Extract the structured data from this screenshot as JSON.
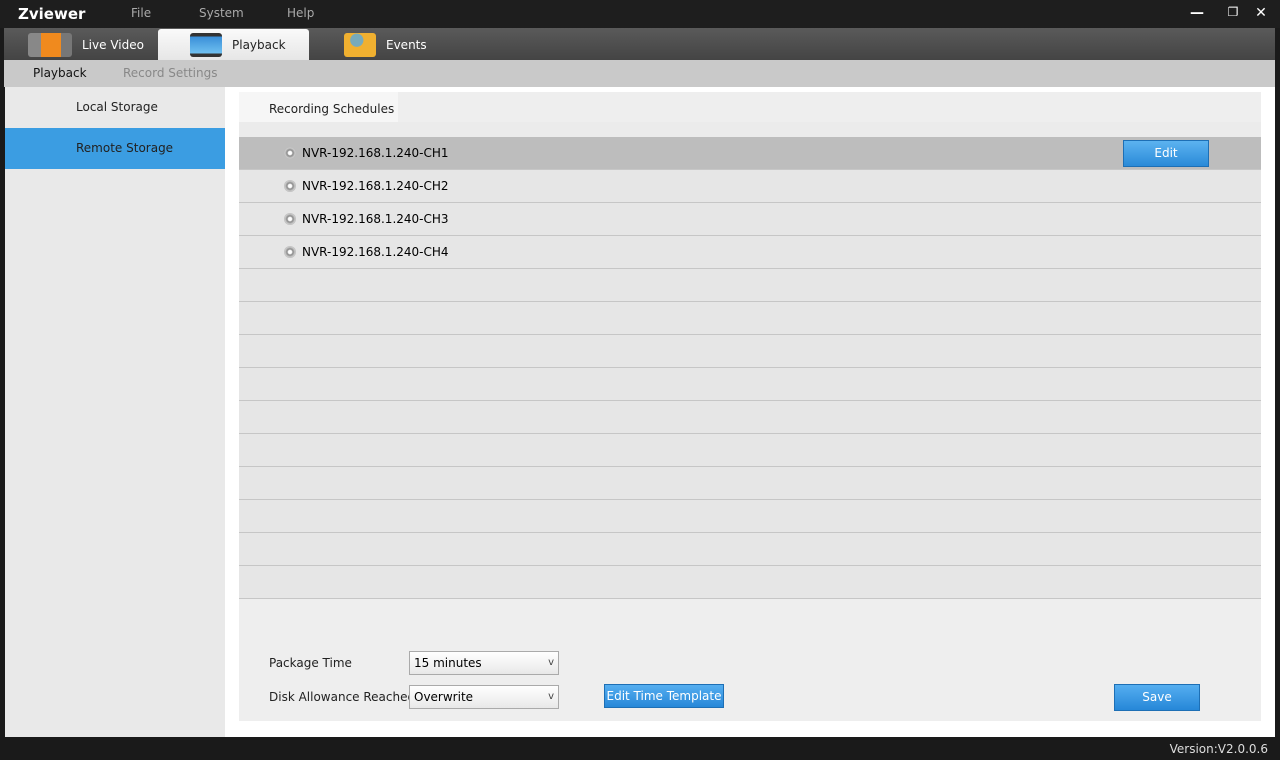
{
  "app": {
    "title": "Zviewer",
    "menu": [
      "File",
      "System",
      "Help"
    ],
    "window_controls": [
      "minimize-icon",
      "restore-icon",
      "close-icon"
    ]
  },
  "tabs": [
    {
      "label": "Live Video",
      "icon": "video-camera-icon"
    },
    {
      "label": "Playback",
      "icon": "filmstrip-icon",
      "active": true
    },
    {
      "label": "Events",
      "icon": "folder-icon"
    }
  ],
  "subtabs": [
    {
      "label": "Playback",
      "active": true
    },
    {
      "label": "Record Settings",
      "active": false
    }
  ],
  "sidebar": {
    "items": [
      {
        "label": "Local Storage"
      },
      {
        "label": "Remote Storage",
        "selected": true
      }
    ]
  },
  "panel": {
    "tab": "Recording Schedules",
    "edit_label": "Edit",
    "channels": [
      "NVR-192.168.1.240-CH1",
      "NVR-192.168.1.240-CH2",
      "NVR-192.168.1.240-CH3",
      "NVR-192.168.1.240-CH4"
    ]
  },
  "settings": {
    "package_time_label": "Package Time",
    "package_time_value": "15 minutes",
    "disk_label": "Disk Allowance Reached",
    "disk_value": "Overwrite",
    "template_button": "Edit Time Template",
    "save_button": "Save"
  },
  "footer": {
    "version": "Version:V2.0.0.6"
  },
  "colors": {
    "accent": "#3b9de2",
    "selected_row": "#bdbdbd"
  }
}
